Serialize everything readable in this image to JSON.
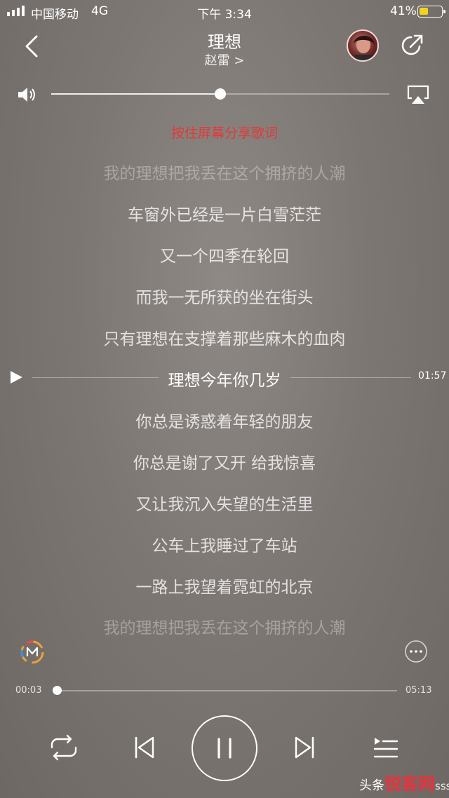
{
  "status_bar": {
    "carrier": "中国移动",
    "network": "4G",
    "time": "下午 3:34",
    "battery_percent": "41%",
    "battery_level": 0.41
  },
  "header": {
    "title": "理想",
    "artist": "赵雷 >",
    "back_icon": "chevron-left-icon",
    "share_icon": "share-arrow-icon"
  },
  "volume": {
    "level": 0.5,
    "icon": "speaker-icon",
    "airplay_icon": "airplay-icon"
  },
  "lyrics": {
    "share_hint": "按住屏幕分享歌词",
    "lines": [
      "我的理想把我丢在这个拥挤的人潮",
      "车窗外已经是一片白雪茫茫",
      "又一个四季在轮回",
      "而我一无所获的坐在街头",
      "只有理想在支撑着那些麻木的血肉",
      "理想今年你几岁",
      "你总是诱惑着年轻的朋友",
      "你总是谢了又开 给我惊喜",
      "又让我沉入失望的生活里",
      "公车上我睡过了车站",
      "一路上我望着霓虹的北京",
      "我的理想把我丢在这个拥挤的人潮"
    ],
    "current_index": 5,
    "seek_time": "01:57"
  },
  "playback": {
    "elapsed": "00:03",
    "duration": "05:13",
    "progress": 0.01
  },
  "controls": {
    "repeat_icon": "repeat-icon",
    "prev_icon": "previous-track-icon",
    "pause_icon": "pause-icon",
    "next_icon": "next-track-icon",
    "playlist_icon": "playlist-icon"
  },
  "watermark": {
    "brand": "锐客网",
    "prefix": "头条",
    "user": "sss"
  },
  "colors": {
    "accent_red": "#e03a3a",
    "battery": "#f5d31d"
  }
}
